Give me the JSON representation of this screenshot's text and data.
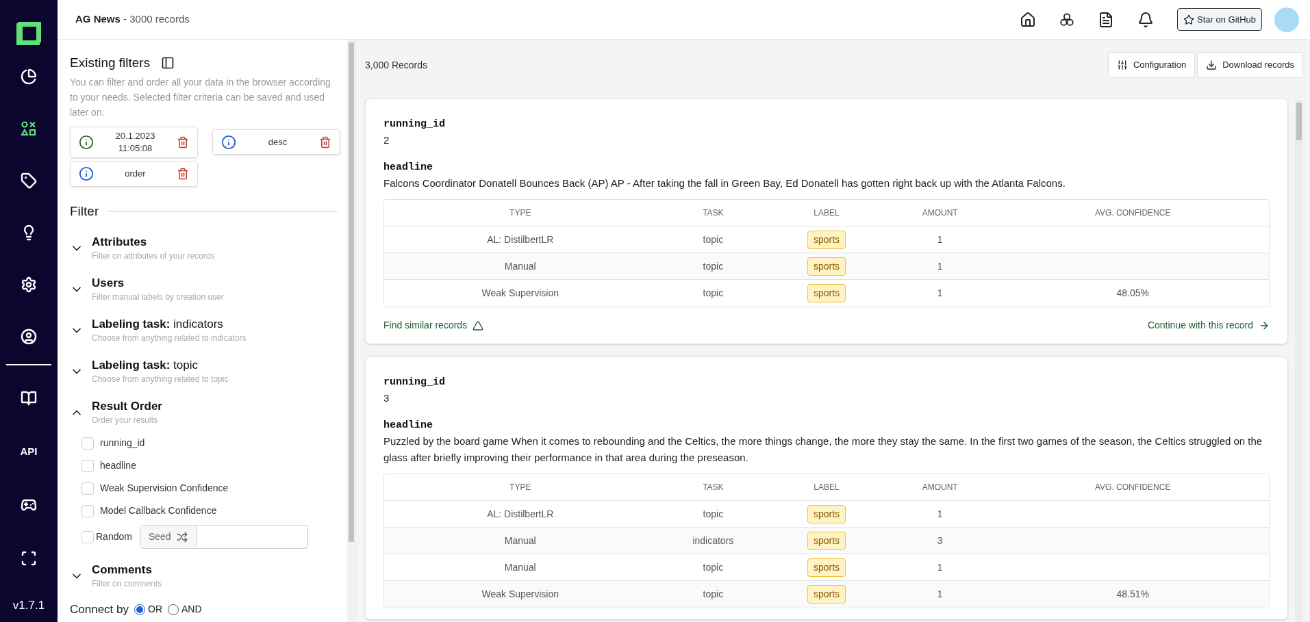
{
  "nav": {
    "items": [
      {
        "selected": false
      },
      {
        "selected": true
      },
      {
        "selected": false
      },
      {
        "selected": false
      },
      {
        "selected": false
      },
      {
        "selected": false
      }
    ],
    "api_label": "API",
    "version": "v1.7.1"
  },
  "header": {
    "project": "AG News",
    "separator": " - ",
    "records": "3000 records",
    "github_button": "Star on GitHub"
  },
  "filters_panel": {
    "title": "Existing filters",
    "description": "You can filter and order all your data in the browser according to your needs. Selected filter criteria can be saved and used later on.",
    "chips": [
      {
        "label": "20.1.2023\n11:05:08",
        "color": "#2e6b2e"
      },
      {
        "label": "desc",
        "color": "#1f5fd6"
      },
      {
        "label": "order",
        "color": "#1f5fd6"
      }
    ],
    "filter_heading": "Filter",
    "sections": [
      {
        "title": "Attributes",
        "subtitle": "Filter on attributes of your records",
        "expanded": false
      },
      {
        "title": "Users",
        "subtitle": "Filter manual labels by creation user",
        "expanded": false
      },
      {
        "title": "Labeling task:",
        "task": "indicators",
        "subtitle": "Choose from anything related to indicators",
        "expanded": false
      },
      {
        "title": "Labeling task:",
        "task": "topic",
        "subtitle": "Choose from anything related to topic",
        "expanded": false
      },
      {
        "title": "Result Order",
        "subtitle": "Order your results",
        "expanded": true,
        "options": [
          {
            "label": "running_id",
            "checked": false
          },
          {
            "label": "headline",
            "checked": false
          },
          {
            "label": "Weak Supervision Confidence",
            "checked": false
          },
          {
            "label": "Model Callback Confidence",
            "checked": false
          }
        ],
        "random": {
          "label": "Random",
          "checked": false,
          "seed_label": "Seed"
        }
      },
      {
        "title": "Comments",
        "subtitle": "Filter on comments",
        "expanded": false
      }
    ],
    "connect": {
      "label": "Connect by",
      "options": [
        {
          "label": "OR",
          "selected": true
        },
        {
          "label": "AND",
          "selected": false
        }
      ]
    }
  },
  "records": {
    "count": "3,000 Records",
    "buttons": [
      "Configuration",
      "Download records"
    ],
    "items": [
      {
        "fields": [
          {
            "name": "running_id",
            "value": "2"
          },
          {
            "name": "headline",
            "value": "Falcons Coordinator Donatell Bounces Back (AP) AP - After taking the fall in Green Bay, Ed Donatell has gotten right back up with the Atlanta Falcons."
          }
        ],
        "columns": [
          "TYPE",
          "TASK",
          "LABEL",
          "AMOUNT",
          "AVG. CONFIDENCE"
        ],
        "rows": [
          {
            "type": "AL: DistilbertLR",
            "task": "topic",
            "label": "sports",
            "amount": "1"
          },
          {
            "type": "Manual",
            "task": "topic",
            "label": "sports",
            "amount": "1"
          },
          {
            "type": "Weak Supervision",
            "task": "topic",
            "label": "sports",
            "amount": "1",
            "confidence": "48.05%"
          }
        ],
        "find_similar": "Find similar records",
        "continue": "Continue with this record"
      },
      {
        "fields": [
          {
            "name": "running_id",
            "value": "3"
          },
          {
            "name": "headline",
            "value": "Puzzled by the board game When it comes to rebounding and the Celtics, the more things change, the more they stay the same. In the first two games of the season, the Celtics struggled on the glass after briefly improving their performance in that area during the preseason."
          }
        ],
        "columns": [
          "TYPE",
          "TASK",
          "LABEL",
          "AMOUNT",
          "AVG. CONFIDENCE"
        ],
        "rows": [
          {
            "type": "AL: DistilbertLR",
            "task": "topic",
            "label": "sports",
            "amount": "1"
          },
          {
            "type": "Manual",
            "task": "indicators",
            "label": "sports",
            "amount": "3"
          },
          {
            "type": "Manual",
            "task": "topic",
            "label": "sports",
            "amount": "1"
          },
          {
            "type": "Weak Supervision",
            "task": "topic",
            "label": "sports",
            "amount": "1",
            "confidence": "48.51%"
          }
        ]
      }
    ]
  }
}
